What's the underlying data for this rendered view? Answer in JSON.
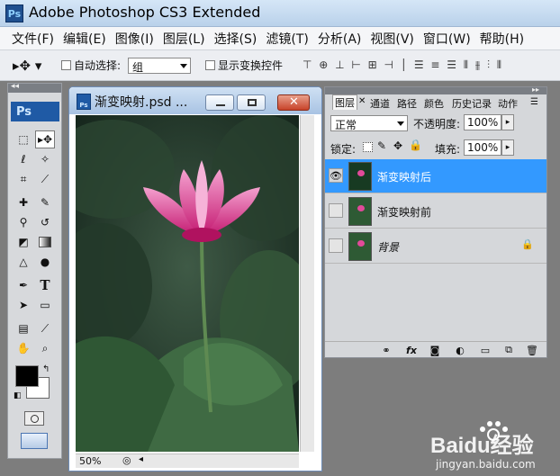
{
  "app": {
    "title": "Adobe Photoshop CS3 Extended",
    "logo": "Ps"
  },
  "menu": [
    "文件(F)",
    "编辑(E)",
    "图像(I)",
    "图层(L)",
    "选择(S)",
    "滤镜(T)",
    "分析(A)",
    "视图(V)",
    "窗口(W)",
    "帮助(H)"
  ],
  "options": {
    "auto_select_label": "自动选择:",
    "auto_select_value": "组",
    "show_transform_label": "显示变换控件"
  },
  "toolbox": {
    "logo": "Ps"
  },
  "document": {
    "title": "渐变映射.psd ...",
    "zoom": "50%"
  },
  "layers_panel": {
    "tabs": [
      "图层",
      "通道",
      "路径",
      "颜色",
      "历史记录",
      "动作"
    ],
    "active_tab": "图层",
    "blend_mode": "正常",
    "opacity_label": "不透明度:",
    "opacity_value": "100%",
    "lock_label": "锁定:",
    "fill_label": "填充:",
    "fill_value": "100%",
    "layers": [
      {
        "name": "渐变映射后",
        "selected": true,
        "visible": true
      },
      {
        "name": "渐变映射前",
        "selected": false,
        "visible": false
      },
      {
        "name": "背景",
        "selected": false,
        "visible": false,
        "locked": true
      }
    ]
  },
  "watermark": {
    "brand": "Baidu经验",
    "url": "jingyan.baidu.com"
  },
  "colors": {
    "selection": "#3399ff",
    "lotus": "#e24a9a",
    "ps_blue": "#1f5aa5"
  }
}
